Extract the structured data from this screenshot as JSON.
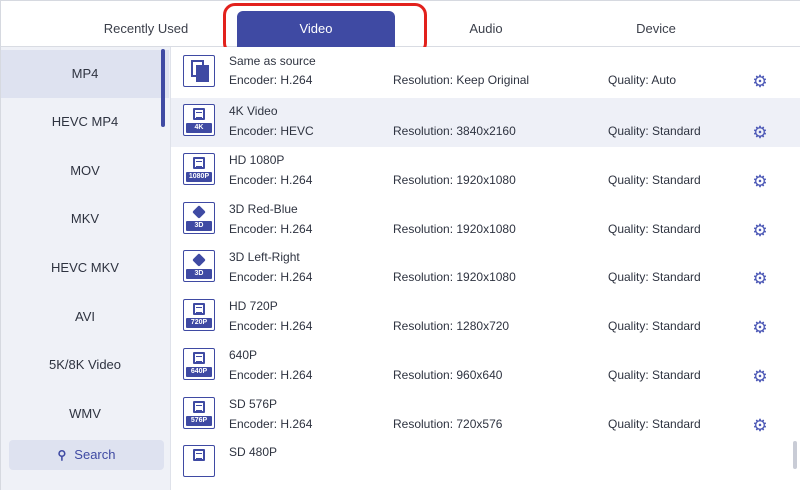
{
  "tabs": [
    {
      "label": "Recently Used"
    },
    {
      "label": "Video"
    },
    {
      "label": "Audio"
    },
    {
      "label": "Device"
    }
  ],
  "sidebar": {
    "items": [
      {
        "label": "MP4"
      },
      {
        "label": "HEVC MP4"
      },
      {
        "label": "MOV"
      },
      {
        "label": "MKV"
      },
      {
        "label": "HEVC MKV"
      },
      {
        "label": "AVI"
      },
      {
        "label": "5K/8K Video"
      },
      {
        "label": "WMV"
      }
    ],
    "selected": "MP4",
    "search_label": "Search"
  },
  "presets": [
    {
      "name": "Same as source",
      "encoder": "Encoder: H.264",
      "resolution": "Resolution: Keep Original",
      "quality": "Quality: Auto",
      "icon": "copy-icon",
      "tag": ""
    },
    {
      "name": "4K Video",
      "encoder": "Encoder: HEVC",
      "resolution": "Resolution: 3840x2160",
      "quality": "Quality: Standard",
      "icon": "film-icon",
      "tag": "4K"
    },
    {
      "name": "HD 1080P",
      "encoder": "Encoder: H.264",
      "resolution": "Resolution: 1920x1080",
      "quality": "Quality: Standard",
      "icon": "film-icon",
      "tag": "1080P"
    },
    {
      "name": "3D Red-Blue",
      "encoder": "Encoder: H.264",
      "resolution": "Resolution: 1920x1080",
      "quality": "Quality: Standard",
      "icon": "3d-cube-icon",
      "tag": "3D"
    },
    {
      "name": "3D Left-Right",
      "encoder": "Encoder: H.264",
      "resolution": "Resolution: 1920x1080",
      "quality": "Quality: Standard",
      "icon": "3d-cube-icon",
      "tag": "3D"
    },
    {
      "name": "HD 720P",
      "encoder": "Encoder: H.264",
      "resolution": "Resolution: 1280x720",
      "quality": "Quality: Standard",
      "icon": "film-icon",
      "tag": "720P"
    },
    {
      "name": "640P",
      "encoder": "Encoder: H.264",
      "resolution": "Resolution: 960x640",
      "quality": "Quality: Standard",
      "icon": "film-icon",
      "tag": "640P"
    },
    {
      "name": "SD 576P",
      "encoder": "Encoder: H.264",
      "resolution": "Resolution: 720x576",
      "quality": "Quality: Standard",
      "icon": "film-icon",
      "tag": "576P"
    },
    {
      "name": "SD 480P",
      "encoder": "",
      "resolution": "",
      "quality": "",
      "icon": "film-icon",
      "tag": ""
    }
  ],
  "colors": {
    "accent": "#3f4aa3",
    "highlight": "#e2211c",
    "sidebar_bg": "#eff1f7"
  }
}
